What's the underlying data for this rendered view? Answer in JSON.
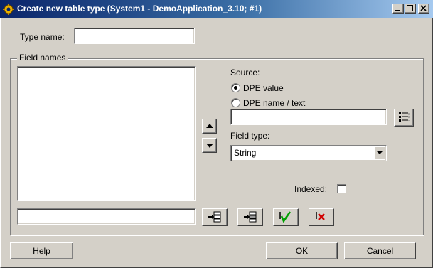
{
  "window": {
    "title": "Create new table type (System1 - DemoApplication_3.10; #1)",
    "minimize_icon": "minimize-icon",
    "maximize_icon": "maximize-icon",
    "close_icon": "close-icon"
  },
  "type_name": {
    "label": "Type name:",
    "value": ""
  },
  "field_names": {
    "legend": "Field names",
    "items": [],
    "new_field_value": ""
  },
  "source": {
    "label": "Source:",
    "options": [
      "DPE value",
      "DPE name / text"
    ],
    "selected": "DPE value",
    "dpe_value": ""
  },
  "field_type": {
    "label": "Field type:",
    "selected": "String"
  },
  "indexed": {
    "label": "Indexed:",
    "checked": false
  },
  "buttons": {
    "help": "Help",
    "ok": "OK",
    "cancel": "Cancel"
  },
  "icons": {
    "move_up": "arrow-up-icon",
    "move_down": "arrow-down-icon",
    "dpe_selector": "dpe-selector-icon",
    "insert_before": "insert-field-icon",
    "insert_after": "append-field-icon",
    "apply": "check-icon",
    "delete": "delete-icon"
  }
}
